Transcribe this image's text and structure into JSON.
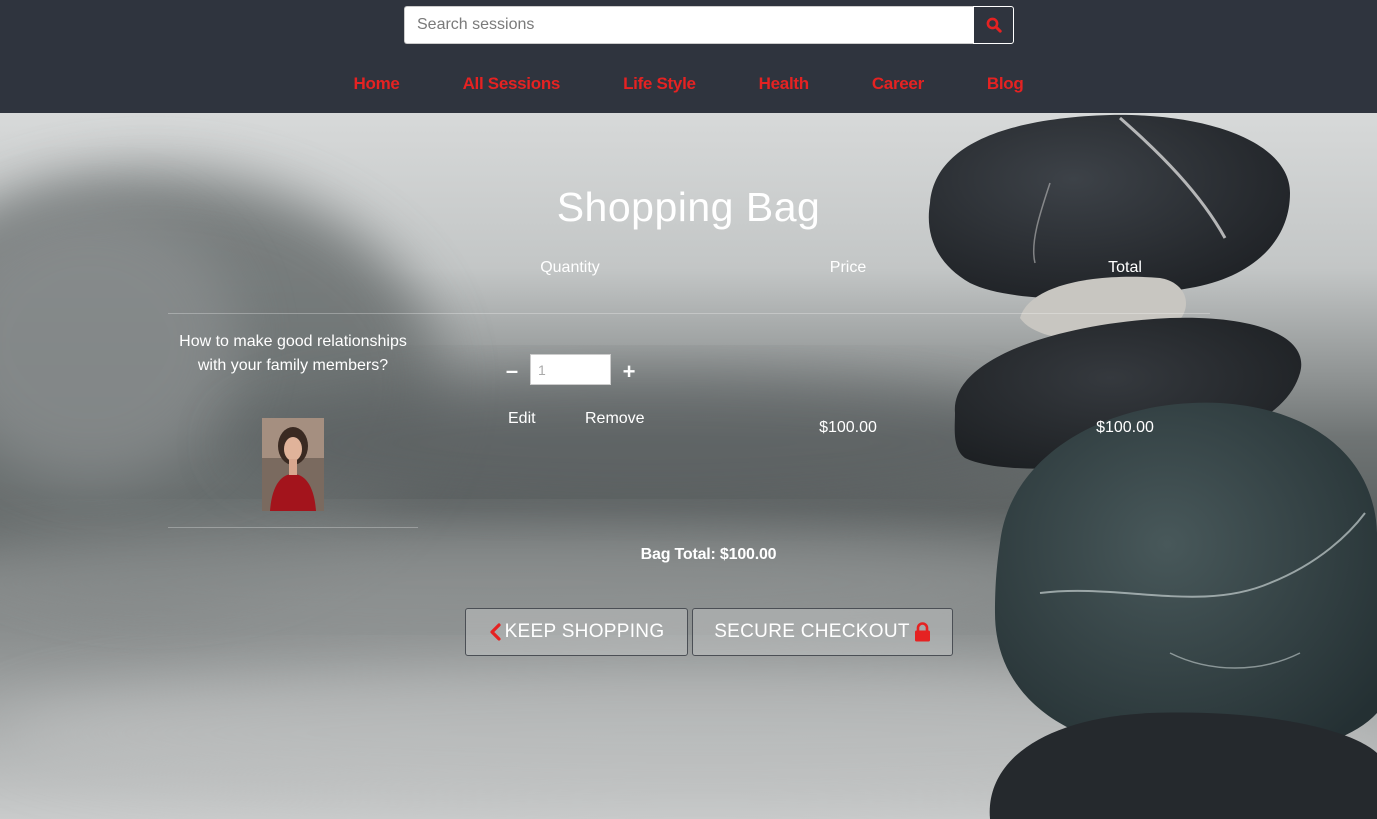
{
  "search": {
    "placeholder": "Search sessions",
    "button_icon": "search-icon"
  },
  "nav": {
    "items": [
      "Home",
      "All Sessions",
      "Life Style",
      "Health",
      "Career",
      "Blog"
    ],
    "color": "#e52222"
  },
  "page": {
    "title": "Shopping Bag"
  },
  "table": {
    "headers": [
      "Quantity",
      "Price",
      "Total"
    ]
  },
  "bag_item": {
    "name": "How to make good relationships with your family members?",
    "quantity": "1",
    "edit_label": "Edit",
    "remove_label": "Remove",
    "price": "$100.00",
    "total": "$100.00"
  },
  "summary": {
    "bag_total": "Bag Total: $100.00"
  },
  "actions": {
    "keep_shopping": "KEEP SHOPPING",
    "secure_checkout": "SECURE CHECKOUT",
    "keep_icon": "chevron-left-icon",
    "checkout_icon": "lock-icon"
  },
  "colors": {
    "header_bg": "#2f343e",
    "accent": "#e52222"
  }
}
